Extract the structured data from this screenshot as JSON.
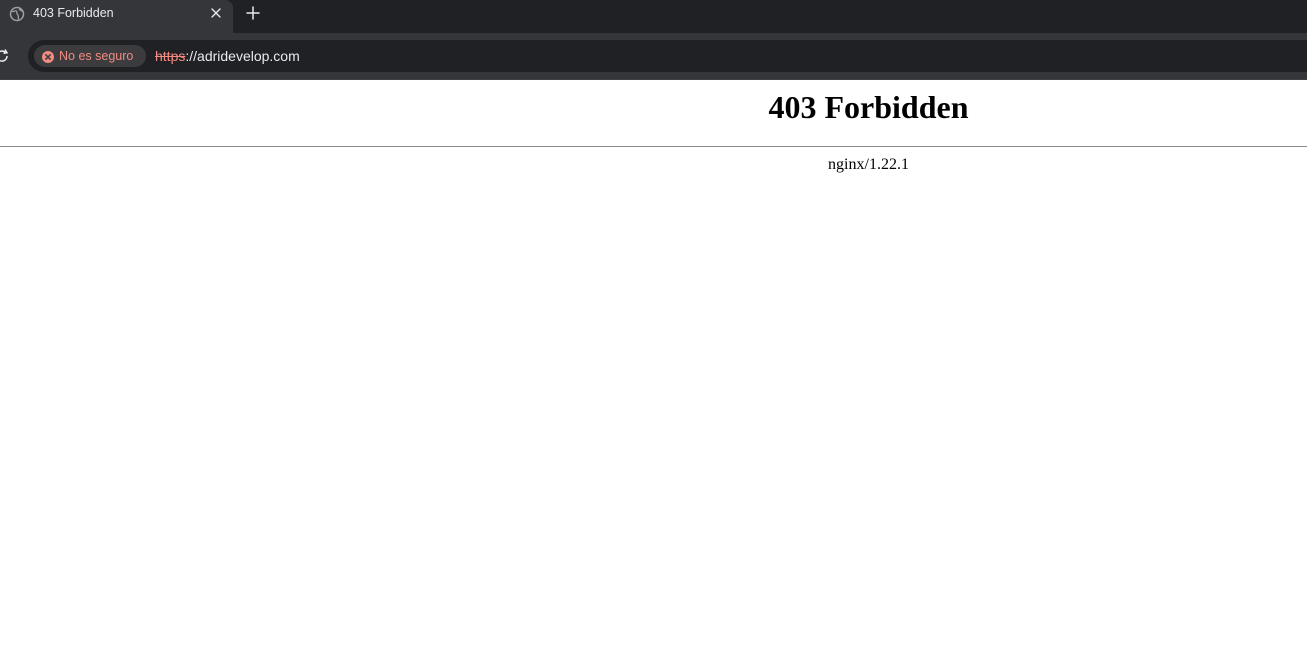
{
  "browser": {
    "tab": {
      "title": "403 Forbidden",
      "favicon": "globe-icon",
      "close_icon": "close-icon"
    },
    "new_tab_icon": "plus-icon",
    "toolbar": {
      "reload_icon": "reload-icon",
      "security_chip": {
        "icon": "error-circle-icon",
        "label": "No es seguro",
        "color": "#f28b82"
      },
      "url": {
        "scheme": "https",
        "rest": "://adridevelop.com"
      }
    }
  },
  "page": {
    "heading": "403 Forbidden",
    "server": "nginx/1.22.1"
  }
}
